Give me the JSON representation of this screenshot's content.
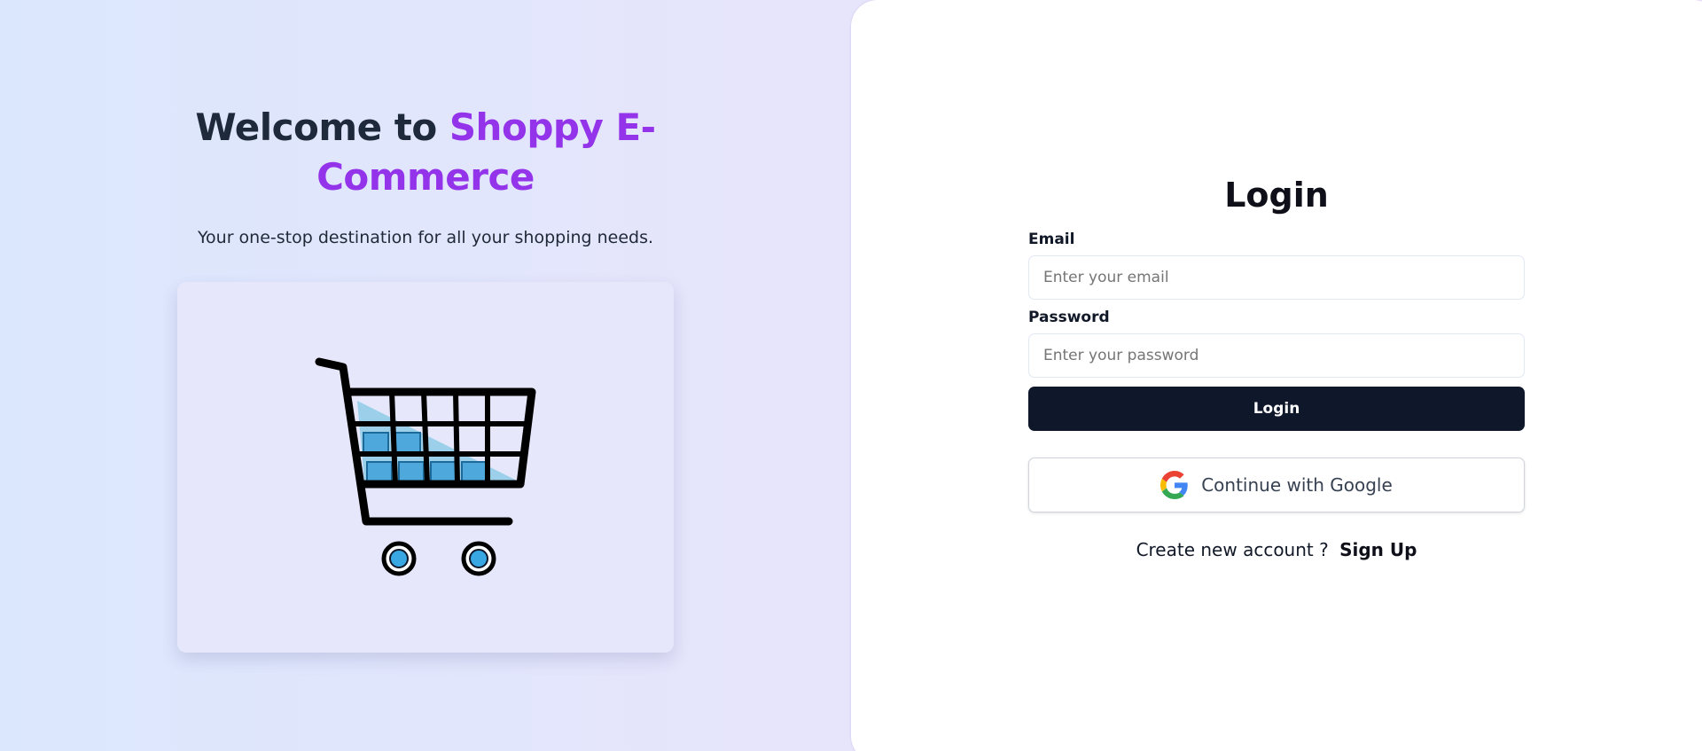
{
  "hero": {
    "title_prefix": "Welcome to",
    "title_brand": "Shoppy E-Commerce",
    "subtitle": "Your one-stop destination for all your shopping needs.",
    "image_icon": "shopping-cart-icon"
  },
  "login": {
    "title": "Login",
    "email_label": "Email",
    "email_placeholder": "Enter your email",
    "email_value": "",
    "password_label": "Password",
    "password_placeholder": "Enter your password",
    "password_value": "",
    "submit_label": "Login",
    "google_label": "Continue with Google",
    "google_icon": "google-icon",
    "signup_prompt": "Create new account ?",
    "signup_link": "Sign Up"
  },
  "colors": {
    "brand": "#9333ea",
    "primary_button": "#0f172a",
    "cart_fill": "#4fa8dc"
  }
}
